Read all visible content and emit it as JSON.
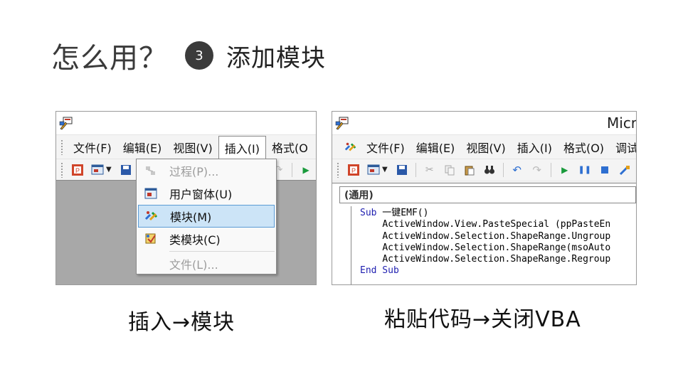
{
  "header": {
    "question": "怎么用？",
    "step_number": "3",
    "step_title": "添加模块"
  },
  "left_window": {
    "menus": [
      "文件(F)",
      "编辑(E)",
      "视图(V)",
      "插入(I)",
      "格式(O"
    ],
    "insert_menu": {
      "items": [
        {
          "label": "过程(P)...",
          "disabled": true
        },
        {
          "label": "用户窗体(U)",
          "disabled": false
        },
        {
          "label": "模块(M)",
          "disabled": false,
          "selected": true
        },
        {
          "label": "类模块(C)",
          "disabled": false
        },
        {
          "label": "文件(L)...",
          "disabled": true
        }
      ]
    }
  },
  "right_window": {
    "title_fragment": "Micr",
    "menus": [
      "文件(F)",
      "编辑(E)",
      "视图(V)",
      "插入(I)",
      "格式(O)",
      "调试"
    ],
    "object_combo": "(通用)",
    "code": {
      "sub_line_keyword": "Sub",
      "sub_line_name": " 一键EMF()",
      "lines": [
        "ActiveWindow.View.PasteSpecial (ppPasteEn",
        "ActiveWindow.Selection.ShapeRange.Ungroup",
        "ActiveWindow.Selection.ShapeRange(msoAuto",
        "ActiveWindow.Selection.ShapeRange.Regroup"
      ],
      "end_line": "End Sub"
    }
  },
  "captions": {
    "left": "插入→模块",
    "right": "粘贴代码→关闭VBA"
  },
  "colors": {
    "step_circle": "#3b3b3b",
    "selected_item_bg": "#cce4f7",
    "selected_item_border": "#5b9bd5",
    "workspace_gray": "#a8a8a8",
    "vba_keyword": "#1f1fb0"
  }
}
